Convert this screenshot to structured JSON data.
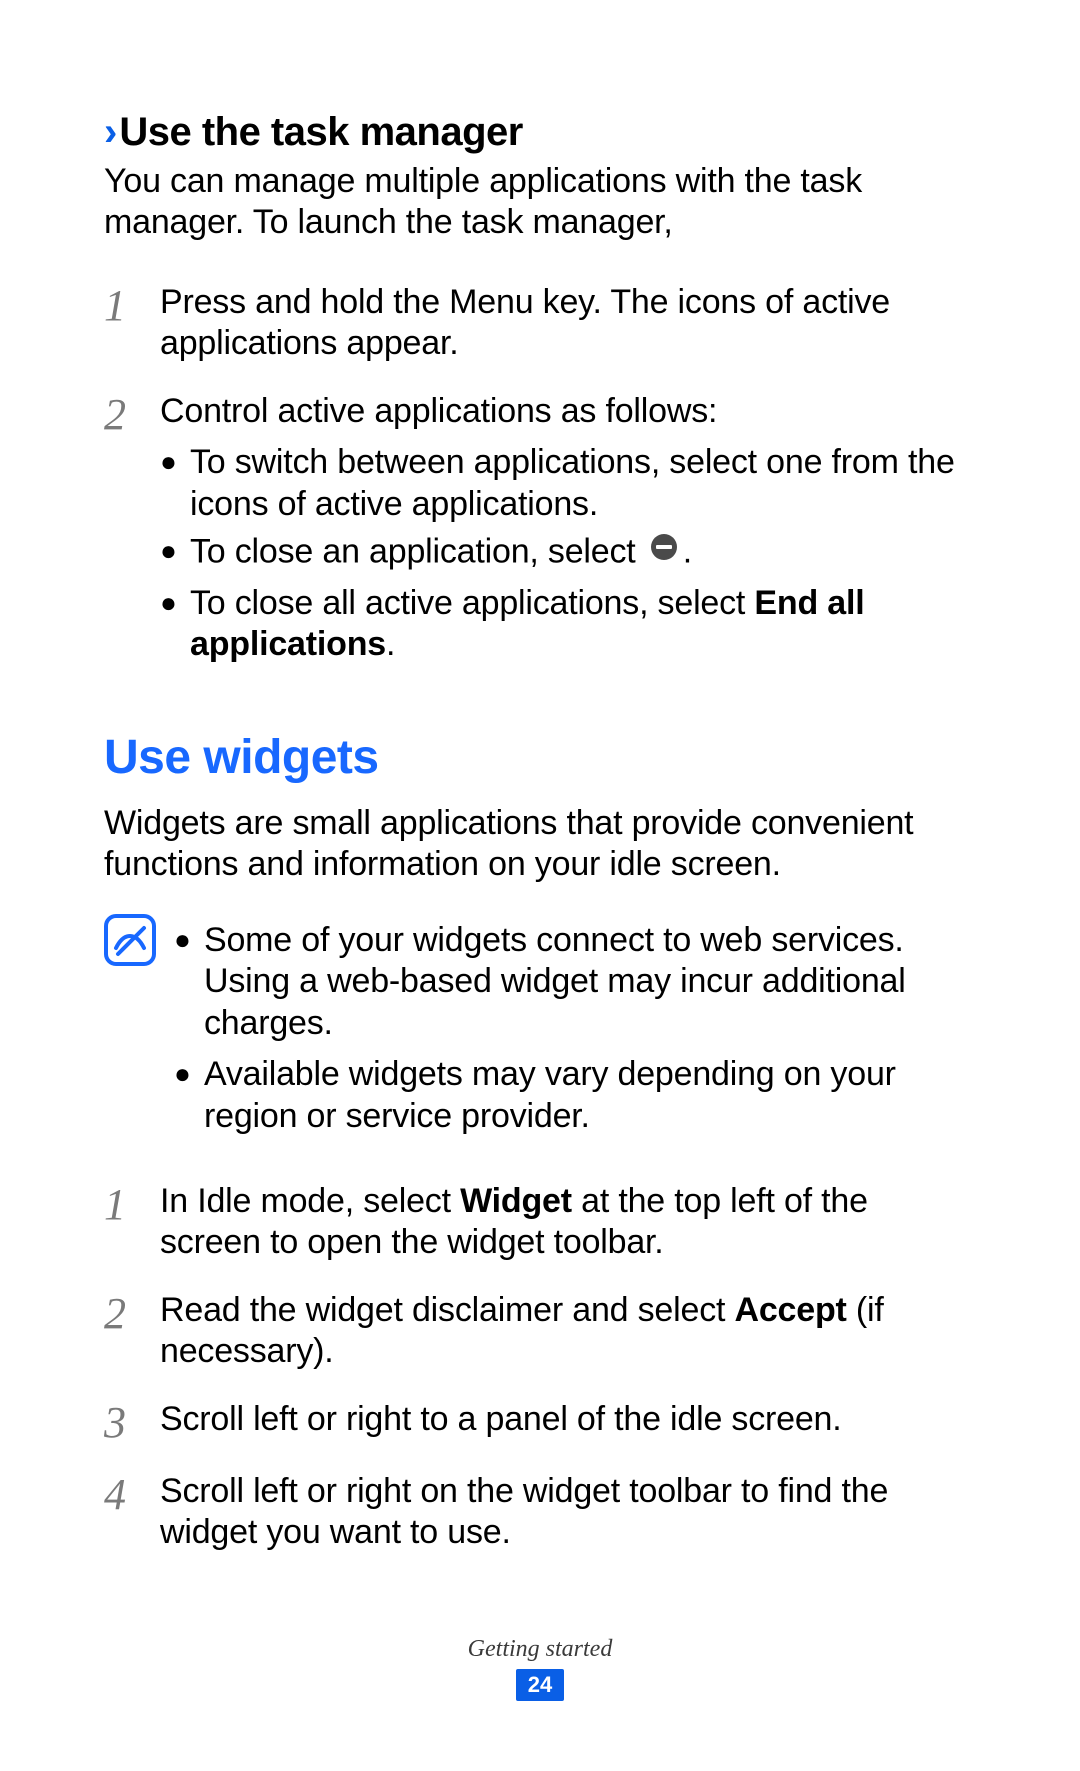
{
  "section1": {
    "chevron": "›",
    "title": "Use the task manager",
    "intro": "You can manage multiple applications with the task manager. To launch the task manager,",
    "step1_num": "1",
    "step1_text": "Press and hold the Menu key. The icons of active applications appear.",
    "step2_num": "2",
    "step2_lead": "Control active applications as follows:",
    "bullet_a": "To switch between applications, select one from the icons of active applications.",
    "bullet_b_pre": "To close an application, select ",
    "bullet_b_post": ".",
    "bullet_c_pre": "To close all active applications, select ",
    "bullet_c_bold1": "End all applications",
    "bullet_c_post": "."
  },
  "section2": {
    "title": "Use widgets",
    "intro": "Widgets are small applications that provide convenient functions and information on your idle screen.",
    "note_a": "Some of your widgets connect to web services. Using a web-based widget may incur additional charges.",
    "note_b": "Available widgets may vary depending on your region or service provider.",
    "step1_num": "1",
    "step1_pre": "In Idle mode, select ",
    "step1_bold": "Widget",
    "step1_post": " at the top left of the screen to open the widget toolbar.",
    "step2_num": "2",
    "step2_pre": "Read the widget disclaimer and select ",
    "step2_bold": "Accept",
    "step2_post": " (if necessary).",
    "step3_num": "3",
    "step3_text": "Scroll left or right to a panel of the idle screen.",
    "step4_num": "4",
    "step4_text": "Scroll left or right on the widget toolbar to find the widget you want to use."
  },
  "footer": {
    "section_label": "Getting started",
    "page_number": "24"
  }
}
